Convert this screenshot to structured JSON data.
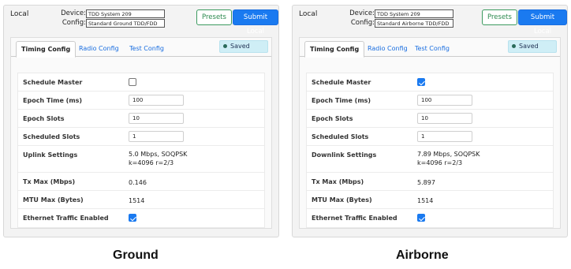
{
  "panels": [
    {
      "local": "Local",
      "device_label": "Device:",
      "device_value": "TDD System 209",
      "config_label": "Config:",
      "config_value": "Standard Ground TDD/FDD",
      "presets": "Presets",
      "submit": "Submit Local",
      "tabs": [
        "Timing Config",
        "Radio Config",
        "Test Config"
      ],
      "saved": "Saved",
      "rows": {
        "schedule_master": "Schedule Master",
        "epoch_time": "Epoch Time (ms)",
        "epoch_time_value": "100",
        "epoch_slots": "Epoch Slots",
        "epoch_slots_value": "10",
        "scheduled_slots": "Scheduled Slots",
        "scheduled_slots_value": "1",
        "link_settings": "Uplink Settings",
        "link_line1": "5.0 Mbps, SOQPSK",
        "link_line2": "k=4096 r=2/3",
        "tx_max": "Tx Max (Mbps)",
        "tx_max_value": "0.146",
        "mtu_max": "MTU Max (Bytes)",
        "mtu_max_value": "1514",
        "ethernet": "Ethernet Traffic Enabled"
      },
      "schedule_master_checked": false,
      "ethernet_checked": true,
      "caption": "Ground"
    },
    {
      "local": "Local",
      "device_label": "Device:",
      "device_value": "TDD System 209",
      "config_label": "Config:",
      "config_value": "Standard Airborne TDD/FDD",
      "presets": "Presets",
      "submit": "Submit Local",
      "tabs": [
        "Timing Config",
        "Radio Config",
        "Test Config"
      ],
      "saved": "Saved",
      "rows": {
        "schedule_master": "Schedule Master",
        "epoch_time": "Epoch Time (ms)",
        "epoch_time_value": "100",
        "epoch_slots": "Epoch Slots",
        "epoch_slots_value": "10",
        "scheduled_slots": "Scheduled Slots",
        "scheduled_slots_value": "1",
        "link_settings": "Downlink Settings",
        "link_line1": "7.89 Mbps, SOQPSK",
        "link_line2": "k=4096 r=2/3",
        "tx_max": "Tx Max (Mbps)",
        "tx_max_value": "5.897",
        "mtu_max": "MTU Max (Bytes)",
        "mtu_max_value": "1514",
        "ethernet": "Ethernet Traffic Enabled"
      },
      "schedule_master_checked": true,
      "ethernet_checked": true,
      "caption": "Airborne"
    }
  ],
  "colors": {
    "accent_blue": "#1a7af0",
    "presets_green": "#2c8a4f",
    "saved_bg": "#cfeef6"
  }
}
